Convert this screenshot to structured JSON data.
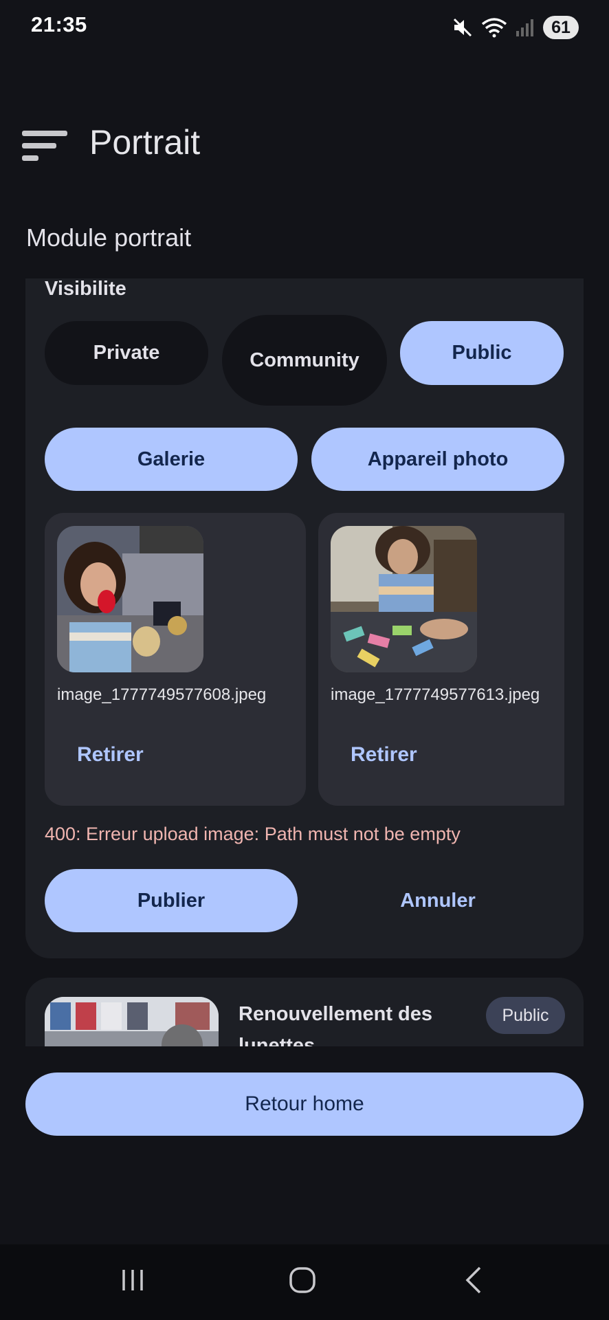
{
  "status_bar": {
    "time": "21:35",
    "battery": "61"
  },
  "app_bar": {
    "title": "Portrait"
  },
  "section_title": "Module portrait",
  "visibility": {
    "label": "Visibilite",
    "options": [
      "Private",
      "Community",
      "Public"
    ],
    "selected": "Public"
  },
  "source_buttons": {
    "gallery": "Galerie",
    "camera": "Appareil photo"
  },
  "images": [
    {
      "filename": "image_1777749577608.jpeg",
      "remove_label": "Retirer"
    },
    {
      "filename": "image_1777749577613.jpeg",
      "remove_label": "Retirer"
    }
  ],
  "error_message": "400: Erreur upload image: Path must not be empty",
  "actions": {
    "publish": "Publier",
    "cancel": "Annuler"
  },
  "post": {
    "title": "Renouvellement des lunettes",
    "badge": "Public"
  },
  "home_button": "Retour home",
  "colors": {
    "accent": "#afc6ff",
    "background": "#121318",
    "card": "#1d1f25",
    "error": "#f0b5b0"
  }
}
